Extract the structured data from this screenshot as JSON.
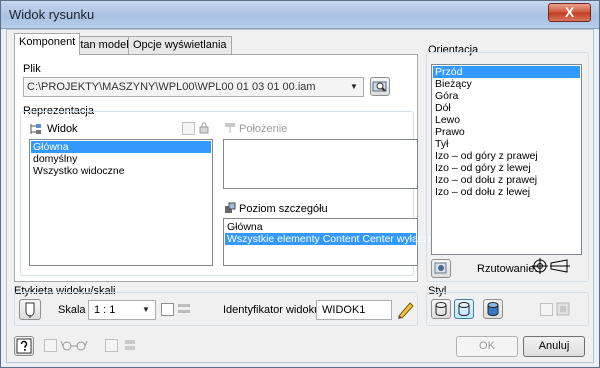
{
  "window": {
    "title": "Widok rysunku",
    "close_glyph": "X"
  },
  "tabs": [
    {
      "label": "Komponent",
      "active": true
    },
    {
      "label": "Stan modelu",
      "active": false
    },
    {
      "label": "Opcje wyświetlania",
      "active": false
    }
  ],
  "file": {
    "label": "Plik",
    "path": "C:\\PROJEKTY\\MASZYNY\\WPL00\\WPL00 01 03 01 00.iam"
  },
  "representation": {
    "label": "Reprezentacja",
    "view": {
      "label": "Widok",
      "items": [
        "Główna",
        "domyślny",
        "Wszystko widoczne"
      ],
      "selected_index": 0
    },
    "position": {
      "label": "Położenie",
      "items": []
    },
    "lod": {
      "label": "Poziom szczegółu",
      "items": [
        "Główna",
        "Wszystkie elementy Content Center wyłączone"
      ],
      "selected_index": 1
    }
  },
  "orientation": {
    "label": "Orientacja",
    "items": [
      "Przód",
      "Bieżący",
      "Góra",
      "Dół",
      "Lewo",
      "Prawo",
      "Tył",
      "Izo – od góry z prawej",
      "Izo – od góry z lewej",
      "Izo – od dołu z prawej",
      "Izo – od dołu z lewej"
    ],
    "selected_index": 0,
    "projection_label": "Rzutowanie:"
  },
  "label_scale": {
    "label": "Etykieta widoku/skali",
    "scale_label": "Skala",
    "scale_value": "1 : 1",
    "view_id_label": "Identyfikator widoku",
    "view_id_value": "WIDOK1"
  },
  "style": {
    "label": "Styl"
  },
  "buttons": {
    "ok": "OK",
    "cancel": "Anuluj"
  },
  "colors": {
    "selection": "#3399ff",
    "title_bar": "#b6cde9",
    "close_button": "#c23b1f"
  }
}
